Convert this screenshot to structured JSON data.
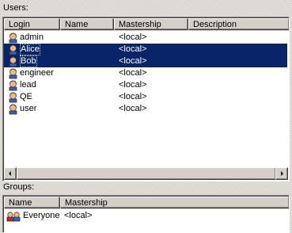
{
  "users_label": "Users:",
  "users_table": {
    "columns": [
      "Login",
      "Name",
      "Mastership",
      "Description"
    ],
    "rows": [
      {
        "login": "admin",
        "name": "",
        "mastership": "<local>",
        "description": "",
        "selected": false
      },
      {
        "login": "Alice",
        "name": "",
        "mastership": "<local>",
        "description": "",
        "selected": true
      },
      {
        "login": "Bob",
        "name": "",
        "mastership": "<local>",
        "description": "",
        "selected": true
      },
      {
        "login": "engineer",
        "name": "",
        "mastership": "<local>",
        "description": "",
        "selected": false
      },
      {
        "login": "lead",
        "name": "",
        "mastership": "<local>",
        "description": "",
        "selected": false
      },
      {
        "login": "QE",
        "name": "",
        "mastership": "<local>",
        "description": "",
        "selected": false
      },
      {
        "login": "user",
        "name": "",
        "mastership": "<local>",
        "description": "",
        "selected": false
      }
    ]
  },
  "groups_label": "Groups:",
  "groups_table": {
    "columns": [
      "Name",
      "Mastership"
    ],
    "rows": [
      {
        "name": "Everyone",
        "mastership": "<local>"
      }
    ]
  },
  "icons": {
    "user": "user-icon",
    "group": "group-icon",
    "scroll_left": "scroll-left-arrow-icon",
    "scroll_right": "scroll-right-arrow-icon"
  },
  "colors": {
    "selection_bg": "#0a246a",
    "selection_text": "#ffffff",
    "face": "#d4d0c8"
  }
}
